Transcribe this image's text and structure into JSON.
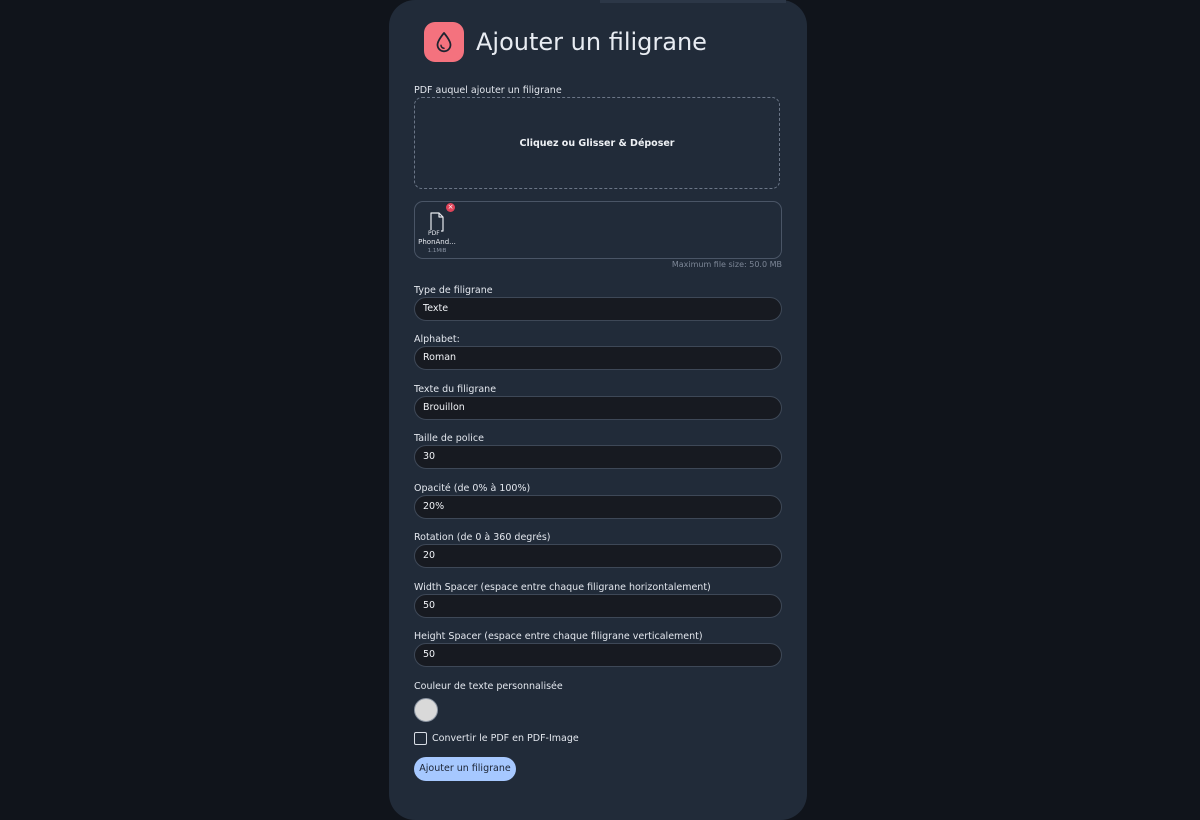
{
  "page": {
    "title": "Ajouter un filigrane",
    "logo_icon": "water-drop-icon"
  },
  "upload": {
    "label": "PDF auquel ajouter un filigrane",
    "dropzone_text": "Cliquez ou Glisser & Déposer",
    "file": {
      "type_label": "PDF",
      "name": "PhonAnd...",
      "size": "1.1MiB"
    },
    "remove_symbol": "×",
    "max_size_text": "Maximum file size: 50.0 MB"
  },
  "fields": {
    "type": {
      "label": "Type de filigrane",
      "value": "Texte"
    },
    "alphabet": {
      "label": "Alphabet:",
      "value": "Roman"
    },
    "text": {
      "label": "Texte du filigrane",
      "value": "Brouillon"
    },
    "font_size": {
      "label": "Taille de police",
      "value": "30"
    },
    "opacity": {
      "label": "Opacité (de 0% à 100%)",
      "value": "20%"
    },
    "rotation": {
      "label": "Rotation (de 0 à 360 degrés)",
      "value": "20"
    },
    "width_spacer": {
      "label": "Width Spacer (espace entre chaque filigrane horizontalement)",
      "value": "50"
    },
    "height_spacer": {
      "label": "Height Spacer (espace entre chaque filigrane verticalement)",
      "value": "50"
    }
  },
  "color": {
    "label": "Couleur de texte personnalisée",
    "value": "#d9d9d9"
  },
  "convert": {
    "label": "Convertir le PDF en PDF-Image",
    "checked": false
  },
  "submit": {
    "label": "Ajouter un filigrane"
  },
  "colors": {
    "background": "#10141b",
    "card": "#212b39",
    "logo": "#f4727e",
    "input_bg": "#171a21",
    "button": "#a6c8ff",
    "remove_badge": "#e0445a"
  }
}
